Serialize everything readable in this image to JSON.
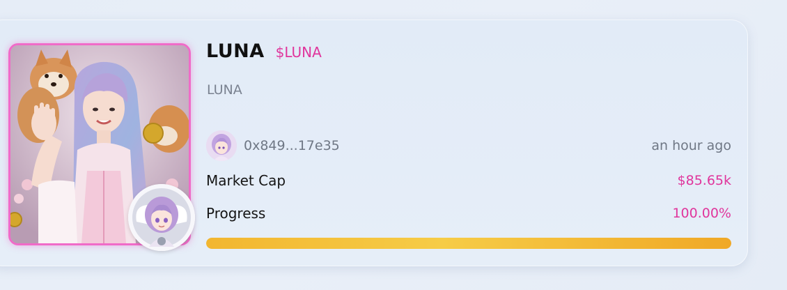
{
  "token": {
    "name": "LUNA",
    "ticker": "$LUNA",
    "description": "LUNA"
  },
  "creator": {
    "address": "0x849...17e35",
    "time_ago": "an hour ago"
  },
  "stats": {
    "market_cap_label": "Market Cap",
    "market_cap_value": "$85.65k",
    "progress_label": "Progress",
    "progress_value": "100.00%",
    "progress_fraction": 1.0
  },
  "colors": {
    "accent_pink": "#e0359c",
    "progress_gold": "#f2b630",
    "frame_pink": "#f06bc8",
    "frame_cyan": "#7fd4e8"
  },
  "icons": {
    "token_image": "anime-girl-with-shiba-dogs-image",
    "badge": "angel-girl-avatar-icon",
    "creator_avatar": "anime-girl-avatar-icon"
  }
}
